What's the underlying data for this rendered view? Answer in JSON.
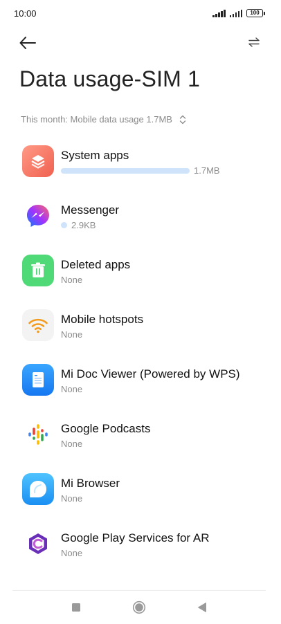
{
  "status_bar": {
    "time": "10:00",
    "battery": "100"
  },
  "header": {
    "title": "Data usage-SIM 1"
  },
  "summary": {
    "text": "This month: Mobile data usage 1.7MB"
  },
  "apps": [
    {
      "name": "System apps",
      "usage": "1.7MB",
      "bar_fraction": 1.0
    },
    {
      "name": "Messenger",
      "usage": "2.9KB"
    },
    {
      "name": "Deleted apps",
      "usage": "None"
    },
    {
      "name": "Mobile hotspots",
      "usage": "None"
    },
    {
      "name": "Mi Doc Viewer (Powered by WPS)",
      "usage": "None"
    },
    {
      "name": "Google Podcasts",
      "usage": "None"
    },
    {
      "name": "Mi Browser",
      "usage": "None"
    },
    {
      "name": "Google Play Services for AR",
      "usage": "None"
    }
  ],
  "icons": {
    "back": "back-arrow-icon",
    "swap": "swap-icon",
    "sort": "sort-toggle-icon",
    "nav": [
      "recents-square-icon",
      "home-circle-icon",
      "back-triangle-icon"
    ]
  },
  "colors": {
    "usage_bar": "#cfe3fb",
    "title": "#222222",
    "muted": "#8a8a8a"
  }
}
